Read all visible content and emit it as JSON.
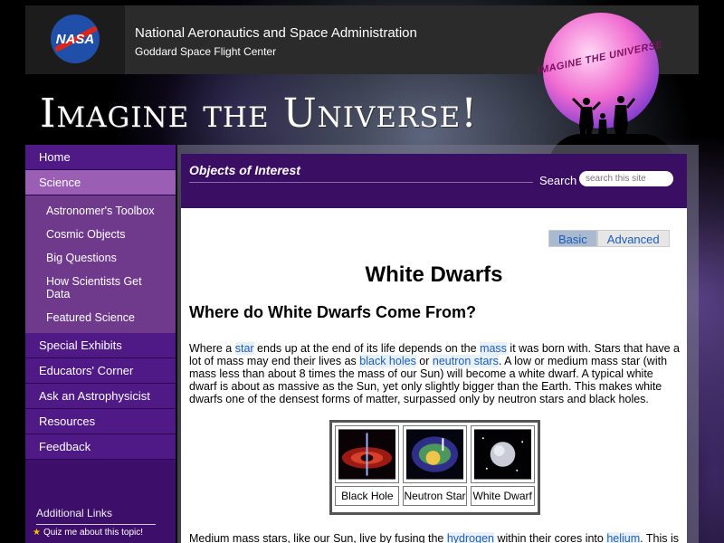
{
  "header": {
    "agency": "National Aeronautics and Space Administration",
    "center": "Goddard Space Flight Center",
    "nasa_logo_text": "NASA",
    "logo_text": "IMAGINE THE UNIVERSE"
  },
  "site_title": "Imagine the Universe!",
  "nav": {
    "items": [
      {
        "label": "Home"
      },
      {
        "label": "Science"
      },
      {
        "label": "Special Exhibits"
      },
      {
        "label": "Educators' Corner"
      },
      {
        "label": "Ask an Astrophysicist"
      },
      {
        "label": "Resources"
      },
      {
        "label": "Feedback"
      }
    ],
    "science_sub": [
      {
        "label": "Astronomer's Toolbox"
      },
      {
        "label": "Cosmic Objects"
      },
      {
        "label": "Big Questions"
      },
      {
        "label": "How Scientists Get Data"
      },
      {
        "label": "Featured Science"
      }
    ],
    "additional_links": "Additional Links",
    "quiz": "Quiz me about this topic!"
  },
  "content_header": {
    "title": "Objects of Interest",
    "search_label": "Search",
    "search_placeholder": "search this site"
  },
  "level_tabs": [
    {
      "label": "Basic",
      "active": true
    },
    {
      "label": "Advanced",
      "active": false
    }
  ],
  "page": {
    "title": "White Dwarfs",
    "subtitle": "Where do White Dwarfs Come From?",
    "para1": {
      "t1": "Where a ",
      "l1": "star",
      "t2": " ends up at the end of its life depends on the ",
      "l2": "mass",
      "t3": " it was born with. Stars that have a lot of mass may end their lives as ",
      "l3": "black holes",
      "t4": " or ",
      "l4": "neutron stars",
      "t5": ". A low or medium mass star (with mass less than about 8 times the mass of our Sun) will become a white dwarf. A typical white dwarf is about as massive as the Sun, yet only slightly bigger than the Earth. This makes white dwarfs one of the densest forms of matter, surpassed only by neutron stars and black holes."
    },
    "objects": [
      {
        "label": "Black Hole",
        "icon": "black-hole-image"
      },
      {
        "label": "Neutron Star",
        "icon": "neutron-star-image"
      },
      {
        "label": "White Dwarf",
        "icon": "white-dwarf-image"
      }
    ],
    "para2": {
      "t1": "Medium mass stars, like our Sun, live by fusing the ",
      "l1": "hydrogen",
      "t2": " within their cores into ",
      "l2": "helium",
      "t3": ". This is"
    }
  },
  "colors": {
    "nav_bg": "#4f1a85",
    "nav_active": "#9a5fb5",
    "sub_bg": "#6f3a8c",
    "header_bg": "#3a0e63",
    "link": "#1d5db8"
  }
}
